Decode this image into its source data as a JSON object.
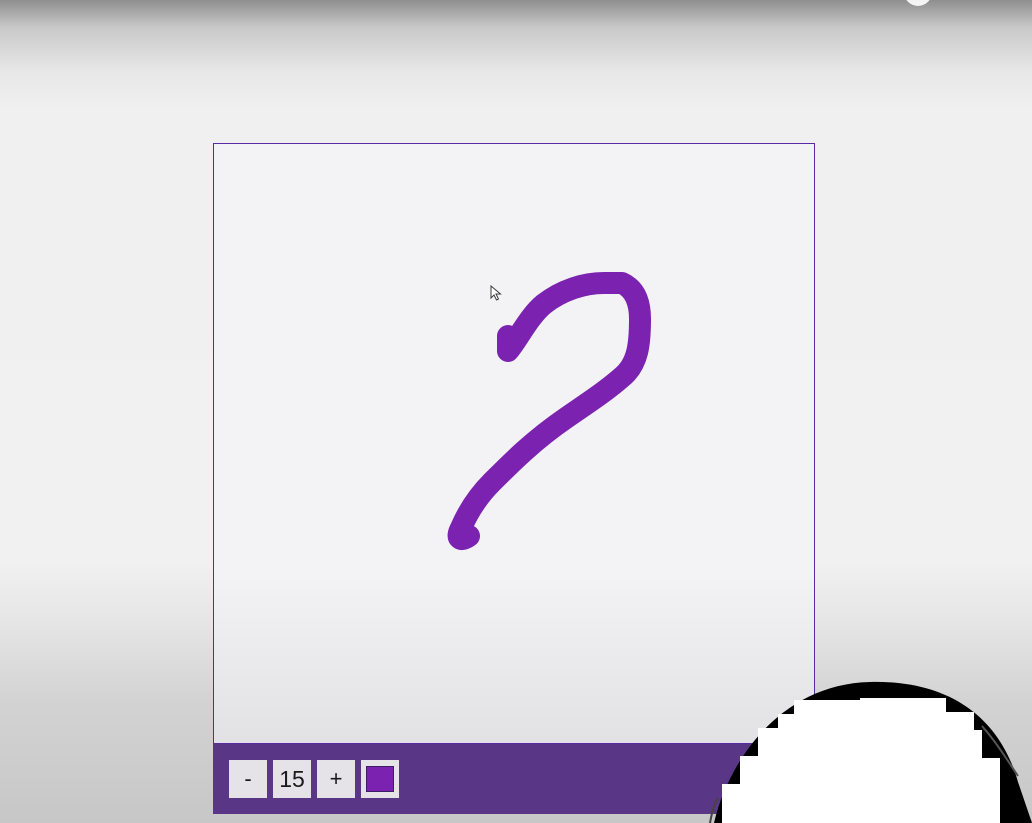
{
  "canvas": {
    "border_color": "#5a2aa2",
    "background_color": "#f3f3f5",
    "stroke_color": "#7b22b0"
  },
  "toolbox": {
    "background_color": "#5a3687",
    "decrease_label": "-",
    "size_value": "15",
    "increase_label": "+",
    "selected_color": "#7b22b0"
  }
}
